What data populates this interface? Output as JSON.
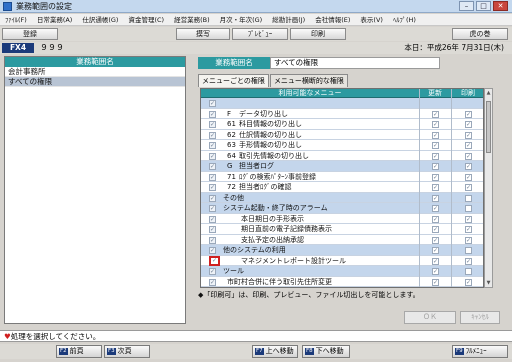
{
  "window": {
    "title": "業務範囲の設定"
  },
  "menu": [
    "ﾌｧｲﾙ(F)",
    "日常業務(A)",
    "仕訳通帳(G)",
    "資金管理(C)",
    "経営業務(B)",
    "月次・年次(G)",
    "総勘計画(J)",
    "会社情報(E)",
    "表示(V)",
    "ﾍﾙﾌﾟ(H)"
  ],
  "toolbar": {
    "register": "登録",
    "transfer": "摸写",
    "preview": "ﾌﾟﾚﾋﾞｭｰ",
    "print": "印刷",
    "tiger": "虎の巻"
  },
  "header": {
    "code_label": "FX4",
    "code_value": "９９９",
    "date_label": "本日：平成26年 7月31日(木)"
  },
  "left_panel": {
    "header": "業務範囲名",
    "items": [
      {
        "label": "会計事務所",
        "selected": false
      },
      {
        "label": "すべての権限",
        "selected": true
      }
    ]
  },
  "right": {
    "name_label": "業務範囲名",
    "name_value": "すべての権限",
    "tabs": [
      "メニューごとの権限",
      "メニュー横断的な権限"
    ],
    "columns": {
      "menu": "利用可能なメニュー",
      "update": "更新",
      "print": "印刷"
    },
    "rows": [
      {
        "indent": 0,
        "code": "",
        "label": "",
        "band": true
      },
      {
        "indent": 1,
        "code": "F",
        "label": "データ切り出し",
        "band": false
      },
      {
        "indent": 1,
        "code": "61",
        "label": "科目情報の切り出し",
        "band": false
      },
      {
        "indent": 1,
        "code": "62",
        "label": "仕訳情報の切り出し",
        "band": false
      },
      {
        "indent": 1,
        "code": "63",
        "label": "手形情報の切り出し",
        "band": false
      },
      {
        "indent": 1,
        "code": "64",
        "label": "取引先情報の切り出し",
        "band": false
      },
      {
        "indent": 1,
        "code": "G",
        "label": "担当者ログ",
        "band": true
      },
      {
        "indent": 1,
        "code": "71",
        "label": "ﾛｸﾞの検索ﾊﾟﾀｰﾝ事前登録",
        "band": false
      },
      {
        "indent": 1,
        "code": "72",
        "label": "担当者ﾛｸﾞの確認",
        "band": false
      },
      {
        "indent": 0,
        "code": "",
        "label": "その他",
        "band": true
      },
      {
        "indent": 0,
        "code": "",
        "label": "システム起動・終了時のアラーム",
        "band": true
      },
      {
        "indent": 2,
        "code": "",
        "label": "本日期日の手形表示",
        "band": false
      },
      {
        "indent": 2,
        "code": "",
        "label": "期日直前の電子記録債務表示",
        "band": false
      },
      {
        "indent": 2,
        "code": "",
        "label": "支払予定の出納承認",
        "band": false
      },
      {
        "indent": 0,
        "code": "",
        "label": "他のシステムの利用",
        "band": true
      },
      {
        "indent": 2,
        "code": "",
        "label": "マネジメントレポート設計ツール",
        "band": false,
        "highlight": true
      },
      {
        "indent": 0,
        "code": "",
        "label": "ツール",
        "band": true
      },
      {
        "indent": 1,
        "code": "",
        "label": "市町村合併に伴う取引先住所変更",
        "band": false
      }
    ],
    "note_symbol": "◆",
    "note": "「印刷可」は、印刷、プレビュー、ファイル切出しを可能とします。",
    "ok": "ＯＫ",
    "cancel": "ｷｬﾝｾﾙ"
  },
  "status": {
    "mark": "♥",
    "text": "処理を選択してください。"
  },
  "fkeys": [
    {
      "key": "F2",
      "label": "前頁"
    },
    {
      "key": "F3",
      "label": "次頁"
    },
    {
      "key": "F7",
      "label": "上へ移動"
    },
    {
      "key": "F8",
      "label": "下へ移動"
    },
    {
      "key": "F9",
      "label": "ﾌﾙﾒﾆｭｰ"
    }
  ]
}
